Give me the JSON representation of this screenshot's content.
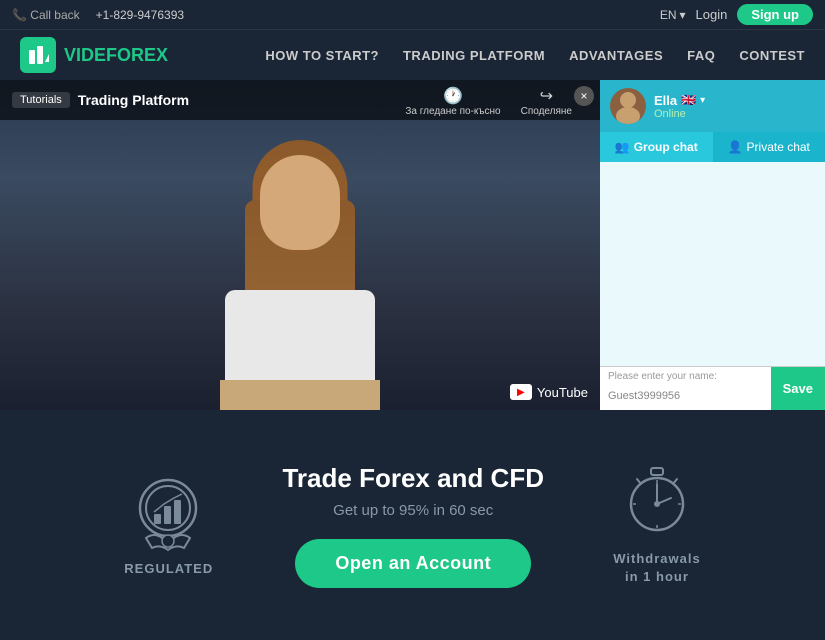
{
  "topbar": {
    "callback_label": "Call back",
    "phone": "+1-829-9476393",
    "lang": "EN",
    "login_label": "Login",
    "signup_label": "Sign up"
  },
  "navbar": {
    "logo_text_1": "VIDE",
    "logo_text_2": "FOREX",
    "nav_items": [
      {
        "label": "HOW TO START?"
      },
      {
        "label": "TRADING PLATFORM"
      },
      {
        "label": "ADVANTAGES"
      },
      {
        "label": "FAQ"
      },
      {
        "label": "CONTEST"
      }
    ]
  },
  "video": {
    "tutorials_label": "Tutorials",
    "title": "Trading Platform",
    "watch_later": "За гледане по-късно",
    "share": "Споделяне",
    "youtube_label": "YouTube",
    "close": "×"
  },
  "chat": {
    "agent_name": "Ella",
    "agent_status": "Online",
    "group_tab": "Group chat",
    "private_tab": "Private chat",
    "input_label": "Please enter your name:",
    "input_value": "Guest3999956",
    "save_btn": "Save"
  },
  "bottom": {
    "regulated_label": "REGULATED",
    "main_title": "Trade Forex and CFD",
    "sub_title": "Get up to 95% in 60 sec",
    "cta_label": "Open an Account",
    "withdrawals_line1": "Withdrawals",
    "withdrawals_line2": "in 1 hour"
  }
}
